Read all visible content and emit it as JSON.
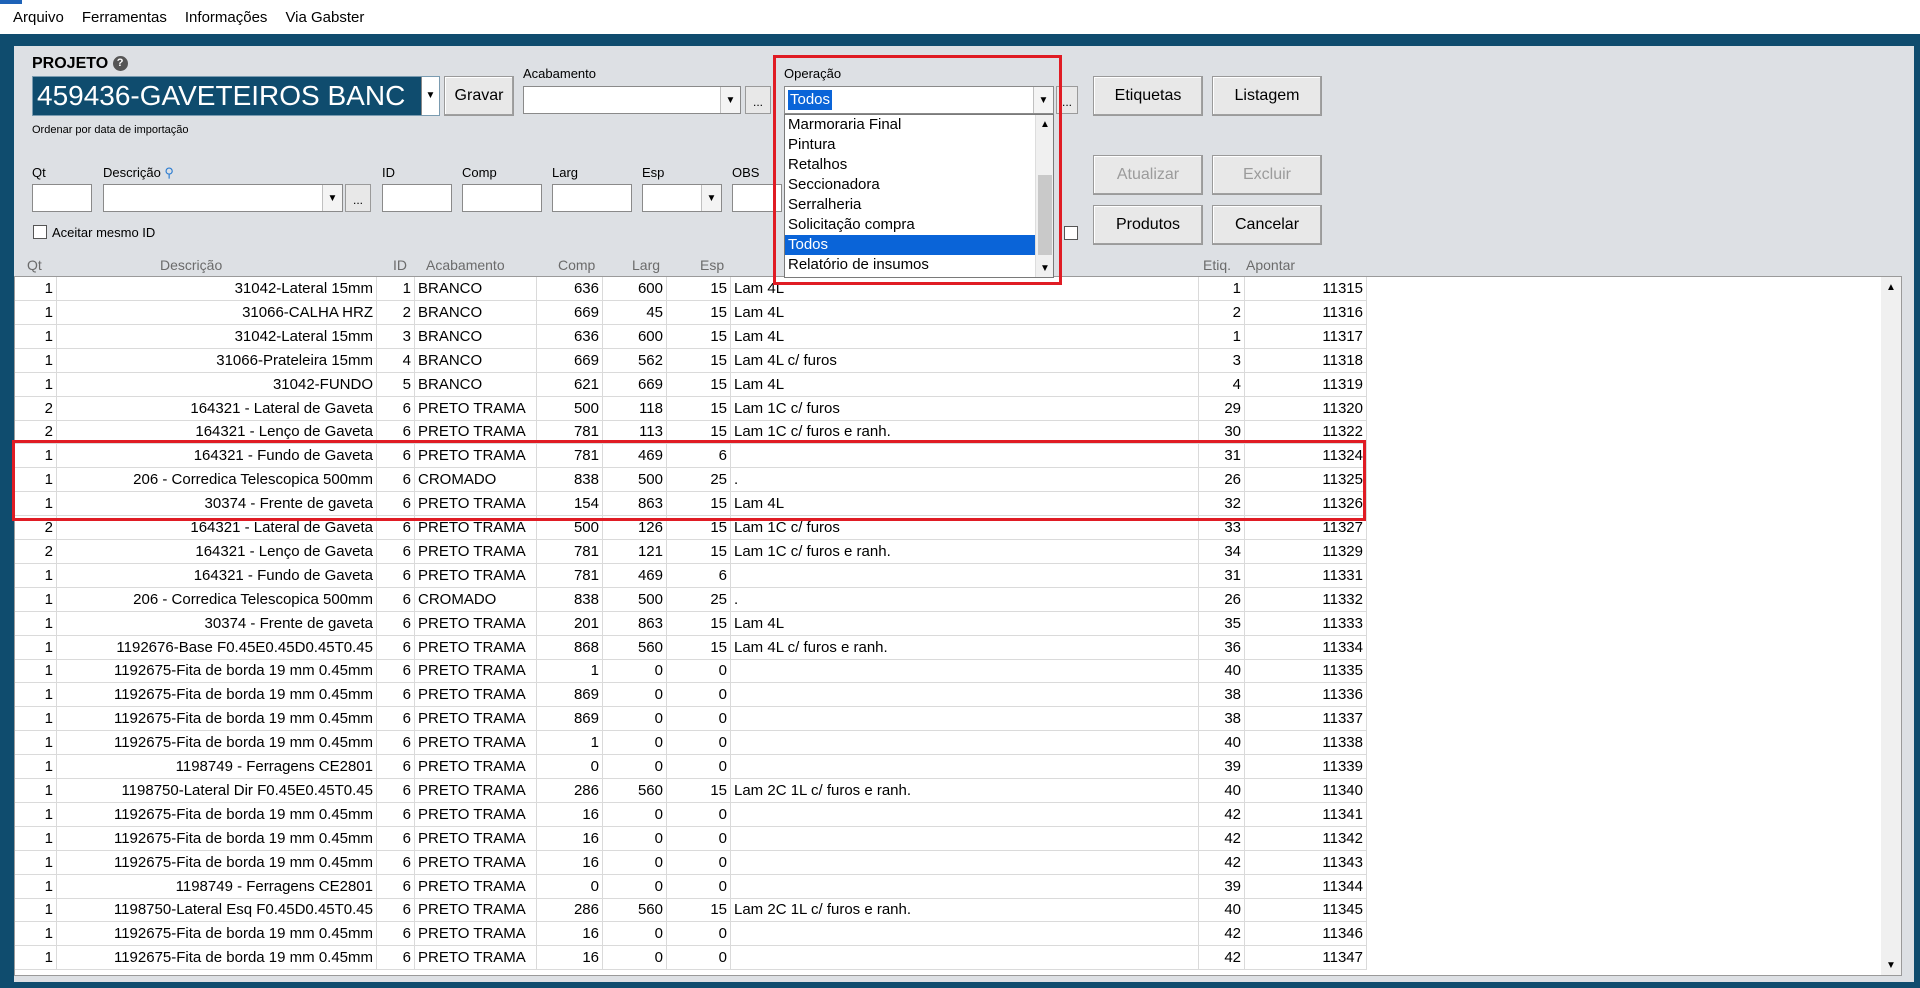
{
  "menu": [
    "Arquivo",
    "Ferramentas",
    "Informações",
    "Via Gabster"
  ],
  "project": {
    "label": "PROJETO",
    "value": "459436-GAVETEIROS BANC",
    "save_button": "Gravar",
    "sort_note": "Ordenar por data de importação"
  },
  "acabamento": {
    "label": "Acabamento",
    "value": "",
    "more": "..."
  },
  "operacao": {
    "label": "Operação",
    "value": "Todos",
    "more": "...",
    "options": [
      "Marmoraria Final",
      "Pintura",
      "Retalhos",
      "Seccionadora",
      "Serralheria",
      "Solicitação compra",
      "Todos",
      "Relatório de insumos"
    ],
    "selected": "Todos"
  },
  "buttons": {
    "etiquetas": "Etiquetas",
    "listagem": "Listagem",
    "atualizar": "Atualizar",
    "excluir": "Excluir",
    "produtos": "Produtos",
    "cancelar": "Cancelar"
  },
  "form": {
    "qt": "Qt",
    "descricao": "Descrição",
    "id": "ID",
    "comp": "Comp",
    "larg": "Larg",
    "esp": "Esp",
    "obs": "OBS",
    "more": "...",
    "aceitar": "Aceitar mesmo ID"
  },
  "columns": [
    "Qt",
    "Descrição",
    "ID",
    "Acabamento",
    "Comp",
    "Larg",
    "Esp",
    "Etiq.",
    "Apontar"
  ],
  "rows": [
    {
      "qt": "1",
      "desc": "31042-Lateral 15mm",
      "id": "1",
      "acab": "BRANCO",
      "comp": "636",
      "larg": "600",
      "esp": "15",
      "obs": "Lam 4L",
      "etiq": "1",
      "apontar": "11315"
    },
    {
      "qt": "1",
      "desc": "31066-CALHA HRZ",
      "id": "2",
      "acab": "BRANCO",
      "comp": "669",
      "larg": "45",
      "esp": "15",
      "obs": "Lam 4L",
      "etiq": "2",
      "apontar": "11316"
    },
    {
      "qt": "1",
      "desc": "31042-Lateral 15mm",
      "id": "3",
      "acab": "BRANCO",
      "comp": "636",
      "larg": "600",
      "esp": "15",
      "obs": "Lam 4L",
      "etiq": "1",
      "apontar": "11317"
    },
    {
      "qt": "1",
      "desc": "31066-Prateleira 15mm",
      "id": "4",
      "acab": "BRANCO",
      "comp": "669",
      "larg": "562",
      "esp": "15",
      "obs": "Lam 4L c/ furos",
      "etiq": "3",
      "apontar": "11318"
    },
    {
      "qt": "1",
      "desc": "31042-FUNDO",
      "id": "5",
      "acab": "BRANCO",
      "comp": "621",
      "larg": "669",
      "esp": "15",
      "obs": "Lam 4L",
      "etiq": "4",
      "apontar": "11319"
    },
    {
      "qt": "2",
      "desc": "164321 - Lateral de Gaveta",
      "id": "6",
      "acab": "PRETO TRAMA",
      "comp": "500",
      "larg": "118",
      "esp": "15",
      "obs": "Lam 1C c/ furos",
      "etiq": "29",
      "apontar": "11320"
    },
    {
      "qt": "2",
      "desc": "164321 - Lenço de Gaveta",
      "id": "6",
      "acab": "PRETO TRAMA",
      "comp": "781",
      "larg": "113",
      "esp": "15",
      "obs": "Lam 1C c/ furos e ranh.",
      "etiq": "30",
      "apontar": "11322"
    },
    {
      "qt": "1",
      "desc": "164321 - Fundo de Gaveta",
      "id": "6",
      "acab": "PRETO TRAMA",
      "comp": "781",
      "larg": "469",
      "esp": "6",
      "obs": "",
      "etiq": "31",
      "apontar": "11324"
    },
    {
      "qt": "1",
      "desc": "206 - Corredica Telescopica 500mm",
      "id": "6",
      "acab": "CROMADO",
      "comp": "838",
      "larg": "500",
      "esp": "25",
      "obs": ".",
      "etiq": "26",
      "apontar": "11325"
    },
    {
      "qt": "1",
      "desc": "30374 - Frente de gaveta",
      "id": "6",
      "acab": "PRETO TRAMA",
      "comp": "154",
      "larg": "863",
      "esp": "15",
      "obs": "Lam 4L",
      "etiq": "32",
      "apontar": "11326"
    },
    {
      "qt": "2",
      "desc": "164321 - Lateral de Gaveta",
      "id": "6",
      "acab": "PRETO TRAMA",
      "comp": "500",
      "larg": "126",
      "esp": "15",
      "obs": "Lam 1C c/ furos",
      "etiq": "33",
      "apontar": "11327"
    },
    {
      "qt": "2",
      "desc": "164321 - Lenço de Gaveta",
      "id": "6",
      "acab": "PRETO TRAMA",
      "comp": "781",
      "larg": "121",
      "esp": "15",
      "obs": "Lam 1C c/ furos e ranh.",
      "etiq": "34",
      "apontar": "11329"
    },
    {
      "qt": "1",
      "desc": "164321 - Fundo de Gaveta",
      "id": "6",
      "acab": "PRETO TRAMA",
      "comp": "781",
      "larg": "469",
      "esp": "6",
      "obs": "",
      "etiq": "31",
      "apontar": "11331"
    },
    {
      "qt": "1",
      "desc": "206 - Corredica Telescopica 500mm",
      "id": "6",
      "acab": "CROMADO",
      "comp": "838",
      "larg": "500",
      "esp": "25",
      "obs": ".",
      "etiq": "26",
      "apontar": "11332"
    },
    {
      "qt": "1",
      "desc": "30374 - Frente de gaveta",
      "id": "6",
      "acab": "PRETO TRAMA",
      "comp": "201",
      "larg": "863",
      "esp": "15",
      "obs": "Lam 4L",
      "etiq": "35",
      "apontar": "11333"
    },
    {
      "qt": "1",
      "desc": "1192676-Base F0.45E0.45D0.45T0.45",
      "id": "6",
      "acab": "PRETO TRAMA",
      "comp": "868",
      "larg": "560",
      "esp": "15",
      "obs": "Lam 4L c/ furos e ranh.",
      "etiq": "36",
      "apontar": "11334"
    },
    {
      "qt": "1",
      "desc": "1192675-Fita de borda 19 mm 0.45mm",
      "id": "6",
      "acab": "PRETO TRAMA",
      "comp": "1",
      "larg": "0",
      "esp": "0",
      "obs": "",
      "etiq": "40",
      "apontar": "11335"
    },
    {
      "qt": "1",
      "desc": "1192675-Fita de borda 19 mm 0.45mm",
      "id": "6",
      "acab": "PRETO TRAMA",
      "comp": "869",
      "larg": "0",
      "esp": "0",
      "obs": "",
      "etiq": "38",
      "apontar": "11336"
    },
    {
      "qt": "1",
      "desc": "1192675-Fita de borda 19 mm 0.45mm",
      "id": "6",
      "acab": "PRETO TRAMA",
      "comp": "869",
      "larg": "0",
      "esp": "0",
      "obs": "",
      "etiq": "38",
      "apontar": "11337"
    },
    {
      "qt": "1",
      "desc": "1192675-Fita de borda 19 mm 0.45mm",
      "id": "6",
      "acab": "PRETO TRAMA",
      "comp": "1",
      "larg": "0",
      "esp": "0",
      "obs": "",
      "etiq": "40",
      "apontar": "11338"
    },
    {
      "qt": "1",
      "desc": "1198749 - Ferragens CE2801",
      "id": "6",
      "acab": "PRETO TRAMA",
      "comp": "0",
      "larg": "0",
      "esp": "0",
      "obs": "",
      "etiq": "39",
      "apontar": "11339"
    },
    {
      "qt": "1",
      "desc": "1198750-Lateral Dir F0.45E0.45T0.45",
      "id": "6",
      "acab": "PRETO TRAMA",
      "comp": "286",
      "larg": "560",
      "esp": "15",
      "obs": "Lam 2C 1L c/ furos e ranh.",
      "etiq": "40",
      "apontar": "11340"
    },
    {
      "qt": "1",
      "desc": "1192675-Fita de borda 19 mm 0.45mm",
      "id": "6",
      "acab": "PRETO TRAMA",
      "comp": "16",
      "larg": "0",
      "esp": "0",
      "obs": "",
      "etiq": "42",
      "apontar": "11341"
    },
    {
      "qt": "1",
      "desc": "1192675-Fita de borda 19 mm 0.45mm",
      "id": "6",
      "acab": "PRETO TRAMA",
      "comp": "16",
      "larg": "0",
      "esp": "0",
      "obs": "",
      "etiq": "42",
      "apontar": "11342"
    },
    {
      "qt": "1",
      "desc": "1192675-Fita de borda 19 mm 0.45mm",
      "id": "6",
      "acab": "PRETO TRAMA",
      "comp": "16",
      "larg": "0",
      "esp": "0",
      "obs": "",
      "etiq": "42",
      "apontar": "11343"
    },
    {
      "qt": "1",
      "desc": "1198749 - Ferragens CE2801",
      "id": "6",
      "acab": "PRETO TRAMA",
      "comp": "0",
      "larg": "0",
      "esp": "0",
      "obs": "",
      "etiq": "39",
      "apontar": "11344"
    },
    {
      "qt": "1",
      "desc": "1198750-Lateral Esq F0.45D0.45T0.45",
      "id": "6",
      "acab": "PRETO TRAMA",
      "comp": "286",
      "larg": "560",
      "esp": "15",
      "obs": "Lam 2C 1L c/ furos e ranh.",
      "etiq": "40",
      "apontar": "11345"
    },
    {
      "qt": "1",
      "desc": "1192675-Fita de borda 19 mm 0.45mm",
      "id": "6",
      "acab": "PRETO TRAMA",
      "comp": "16",
      "larg": "0",
      "esp": "0",
      "obs": "",
      "etiq": "42",
      "apontar": "11346"
    },
    {
      "qt": "1",
      "desc": "1192675-Fita de borda 19 mm 0.45mm",
      "id": "6",
      "acab": "PRETO TRAMA",
      "comp": "16",
      "larg": "0",
      "esp": "0",
      "obs": "",
      "etiq": "42",
      "apontar": "11347"
    }
  ],
  "colors": {
    "frame": "#0f4c6e",
    "highlight_border": "#e01c24",
    "selection": "#0a64d8"
  }
}
